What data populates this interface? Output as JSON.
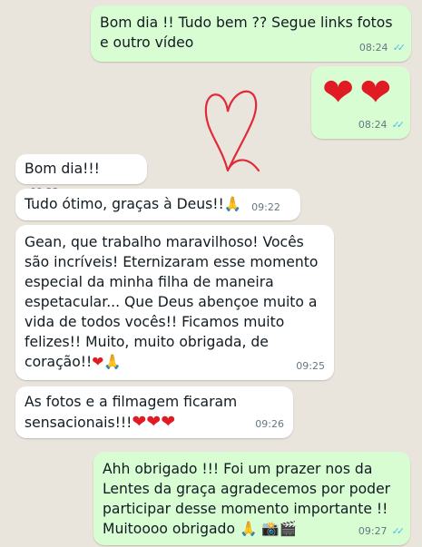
{
  "messages": [
    {
      "text": "Bom dia !! Tudo bem ?? Segue links fotos\ne outro vídeo",
      "time": "08:24",
      "ticks": "✓✓"
    },
    {
      "hearts": [
        "❤",
        "❤"
      ],
      "time": "08:24",
      "ticks": "✓✓"
    },
    {
      "text": "Bom dia!!!",
      "time": "09:22"
    },
    {
      "text": "Tudo ótimo, graças à Deus!!",
      "emoji": "🙏",
      "time": "09:22"
    },
    {
      "text": "Gean, que trabalho maravilhoso! Vocês\nsão incríveis! Eternizaram esse momento\nespecial da minha filha de maneira\nespetacular... Que Deus abençoe muito a\nvida de todos vocês!! Ficamos muito\nfelizes!! Muito, muito obrigada, de\ncoração!!",
      "emoji": "❤🙏",
      "time": "09:25"
    },
    {
      "text": "As fotos e a filmagem ficaram\nsensacionais!!!",
      "emoji": "❤❤❤",
      "time": "09:26"
    },
    {
      "text": "Ahh obrigado !!! Foi um prazer nos da\nLentes da graça agradecemos por poder\nparticipar desse momento importante !!\nMuitoooo obrigado",
      "emoji": "🙏 📸🎬",
      "time": "09:27",
      "ticks": "✓✓"
    }
  ],
  "colors": {
    "outgoing": "#d9fdd3",
    "incoming": "#ffffff",
    "background": "#e9e4dc",
    "read_ticks": "#53bdeb"
  },
  "icons": [
    "read-receipt-icon",
    "heart-emoji",
    "pray-emoji",
    "camera-emoji",
    "clapper-emoji",
    "heart-doodle-sticker"
  ]
}
